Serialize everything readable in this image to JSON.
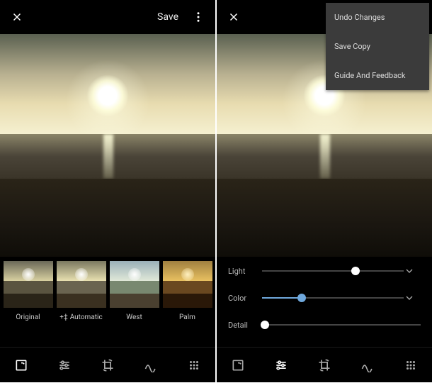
{
  "left": {
    "header": {
      "save_label": "Save"
    },
    "filters": [
      {
        "label": "Original"
      },
      {
        "label": "Automatic"
      },
      {
        "label": "West"
      },
      {
        "label": "Palm"
      }
    ]
  },
  "right": {
    "menu": {
      "undo": "Undo Changes",
      "save_copy": "Save Copy",
      "guide": "Guide And Feedback"
    },
    "sliders": {
      "light": {
        "label": "Light",
        "value": 66
      },
      "color": {
        "label": "Color",
        "value": 28
      },
      "detail": {
        "label": "Detail",
        "value": 2
      }
    }
  }
}
